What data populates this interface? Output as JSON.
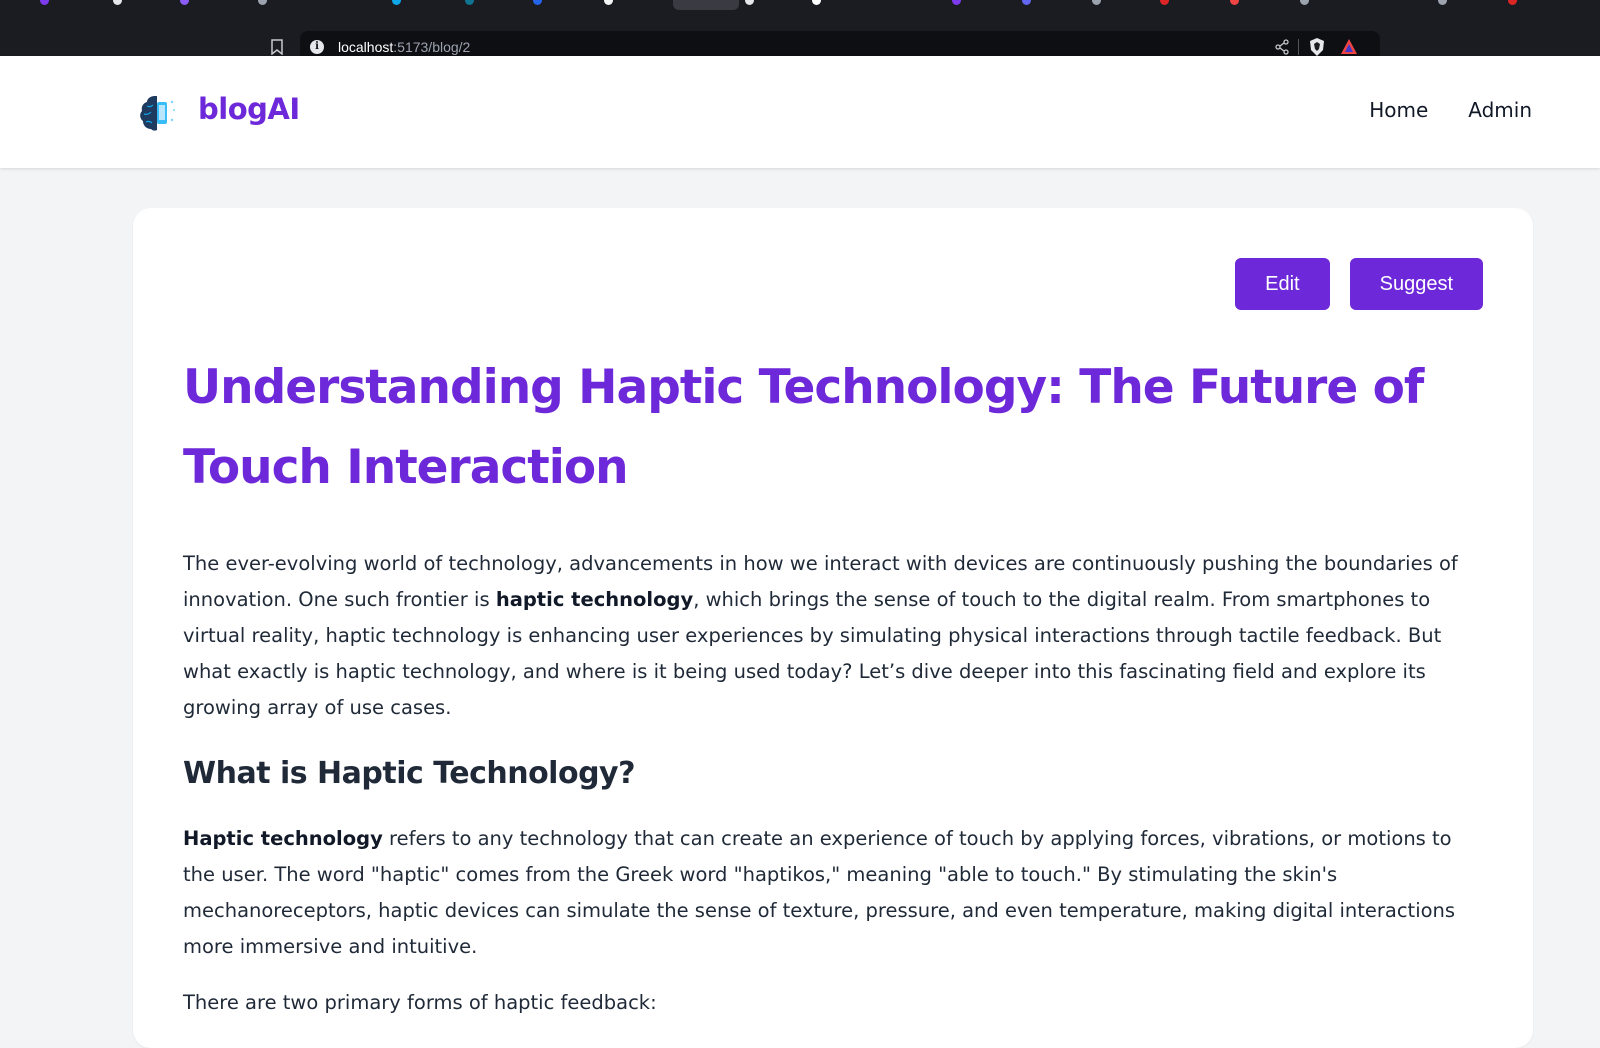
{
  "browser": {
    "url_host": "localhost",
    "url_path": ":5173/blog/2"
  },
  "header": {
    "brand": "blogAI",
    "logo_icon": "brain-logo-icon",
    "nav": [
      "Home",
      "Admin"
    ]
  },
  "actions": {
    "edit_label": "Edit",
    "suggest_label": "Suggest"
  },
  "article": {
    "title": "Understanding Haptic Technology: The Future of Touch Interaction",
    "intro": {
      "before": "The ever-evolving world of technology, advancements in how we interact with devices are continuously pushing the boundaries of innovation. One such frontier is ",
      "bold": "haptic technology",
      "after": ", which brings the sense of touch to the digital realm. From smartphones to virtual reality, haptic technology is enhancing user experiences by simulating physical interactions through tactile feedback. But what exactly is haptic technology, and where is it being used today? Let’s dive deeper into this fascinating field and explore its growing array of use cases."
    },
    "section_heading": "What is Haptic Technology?",
    "definition": {
      "bold": "Haptic technology",
      "after": " refers to any technology that can create an experience of touch by applying forces, vibrations, or motions to the user. The word \"haptic\" comes from the Greek word \"haptikos,\" meaning \"able to touch.\" By stimulating the skin's mechanoreceptors, haptic devices can simulate the sense of texture, pressure, and even temperature, making digital interactions more immersive and intuitive."
    },
    "forms_intro": "There are two primary forms of haptic feedback:"
  },
  "colors": {
    "accent": "#6d28d9",
    "page_bg": "#f3f4f6",
    "browser_chrome": "#1b1c22"
  }
}
